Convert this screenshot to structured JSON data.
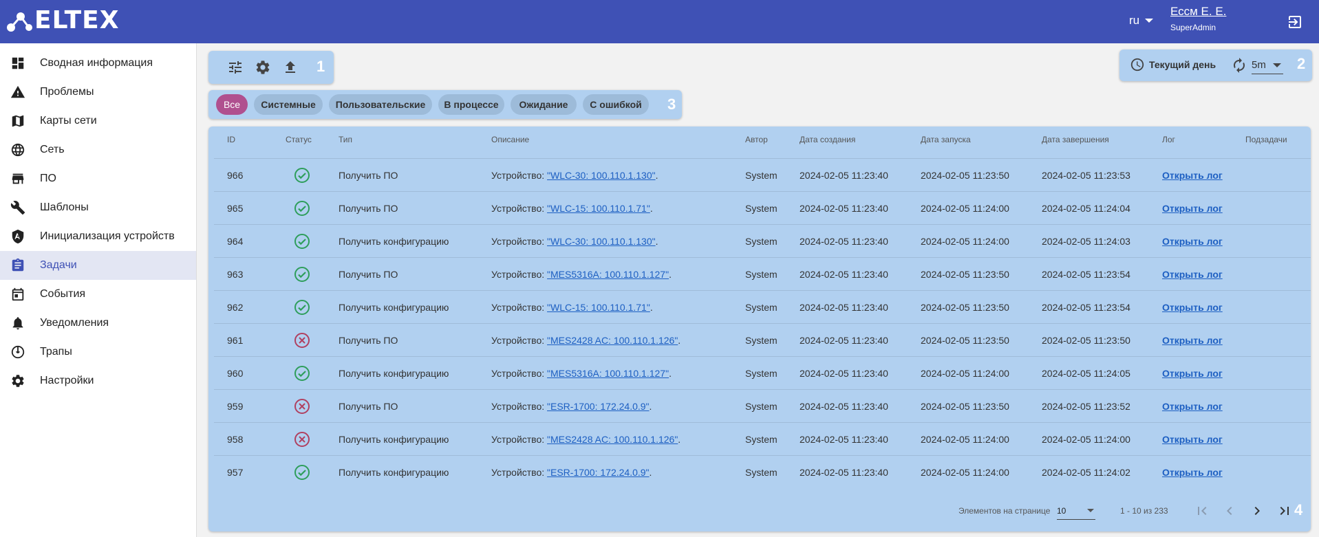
{
  "header": {
    "brand": "ELTEX",
    "lang": "ru",
    "user_name": "Ессм Е. Е.",
    "user_role": "SuperAdmin"
  },
  "sidebar": {
    "items": [
      {
        "label": "Сводная информация",
        "icon": "dashboard-icon"
      },
      {
        "label": "Проблемы",
        "icon": "warning-icon"
      },
      {
        "label": "Карты сети",
        "icon": "map-icon"
      },
      {
        "label": "Сеть",
        "icon": "globe-icon"
      },
      {
        "label": "ПО",
        "icon": "store-icon"
      },
      {
        "label": "Шаблоны",
        "icon": "wrench-icon"
      },
      {
        "label": "Инициализация устройств",
        "icon": "init-icon"
      },
      {
        "label": "Задачи",
        "icon": "clipboard-icon",
        "active": true
      },
      {
        "label": "События",
        "icon": "calendar-icon"
      },
      {
        "label": "Уведомления",
        "icon": "bell-icon"
      },
      {
        "label": "Трапы",
        "icon": "trap-icon"
      },
      {
        "label": "Настройки",
        "icon": "gear-icon"
      }
    ]
  },
  "zones": {
    "z1": "1",
    "z2": "2",
    "z3": "3",
    "z4": "4"
  },
  "toolbar2": {
    "period": "Текущий день",
    "refresh": "5m"
  },
  "filters": [
    "Все",
    "Системные",
    "Пользовательские",
    "В процессе",
    "Ожидание",
    "С ошибкой"
  ],
  "table": {
    "headers": {
      "id": "ID",
      "status": "Статус",
      "type": "Тип",
      "desc": "Описание",
      "author": "Автор",
      "created": "Дата создания",
      "started": "Дата запуска",
      "finished": "Дата завершения",
      "log": "Лог",
      "subtasks": "Подзадачи"
    },
    "rows": [
      {
        "id": "966",
        "status": "ok",
        "type": "Получить ПО",
        "desc_prefix": "Устройство: ",
        "device": "\"WLC-30: 100.110.1.130\"",
        "desc_suffix": " .",
        "author": "System",
        "created": "2024-02-05 11:23:40",
        "started": "2024-02-05 11:23:50",
        "finished": "2024-02-05 11:23:53",
        "log": "Открыть лог"
      },
      {
        "id": "965",
        "status": "ok",
        "type": "Получить ПО",
        "desc_prefix": "Устройство: ",
        "device": "\"WLC-15: 100.110.1.71\"",
        "desc_suffix": " .",
        "author": "System",
        "created": "2024-02-05 11:23:40",
        "started": "2024-02-05 11:24:00",
        "finished": "2024-02-05 11:24:04",
        "log": "Открыть лог"
      },
      {
        "id": "964",
        "status": "ok",
        "type": "Получить конфигурацию",
        "desc_prefix": "Устройство: ",
        "device": "\"WLC-30: 100.110.1.130\"",
        "desc_suffix": " .",
        "author": "System",
        "created": "2024-02-05 11:23:40",
        "started": "2024-02-05 11:24:00",
        "finished": "2024-02-05 11:24:03",
        "log": "Открыть лог"
      },
      {
        "id": "963",
        "status": "ok",
        "type": "Получить ПО",
        "desc_prefix": "Устройство: ",
        "device": "\"MES5316A: 100.110.1.127\"",
        "desc_suffix": " .",
        "author": "System",
        "created": "2024-02-05 11:23:40",
        "started": "2024-02-05 11:23:50",
        "finished": "2024-02-05 11:23:54",
        "log": "Открыть лог"
      },
      {
        "id": "962",
        "status": "ok",
        "type": "Получить конфигурацию",
        "desc_prefix": "Устройство: ",
        "device": "\"WLC-15: 100.110.1.71\"",
        "desc_suffix": ".",
        "author": "System",
        "created": "2024-02-05 11:23:40",
        "started": "2024-02-05 11:23:50",
        "finished": "2024-02-05 11:23:54",
        "log": "Открыть лог"
      },
      {
        "id": "961",
        "status": "error",
        "type": "Получить ПО",
        "desc_prefix": "Устройство: ",
        "device": "\"MES2428 AC: 100.110.1.126\"",
        "desc_suffix": " .",
        "author": "System",
        "created": "2024-02-05 11:23:40",
        "started": "2024-02-05 11:23:50",
        "finished": "2024-02-05 11:23:50",
        "log": "Открыть лог"
      },
      {
        "id": "960",
        "status": "ok",
        "type": "Получить конфигурацию",
        "desc_prefix": "Устройство: ",
        "device": "\"MES5316A: 100.110.1.127\"",
        "desc_suffix": " .",
        "author": "System",
        "created": "2024-02-05 11:23:40",
        "started": "2024-02-05 11:24:00",
        "finished": "2024-02-05 11:24:05",
        "log": "Открыть лог"
      },
      {
        "id": "959",
        "status": "error",
        "type": "Получить ПО",
        "desc_prefix": "Устройство: ",
        "device": "\"ESR-1700: 172.24.0.9\"",
        "desc_suffix": " .",
        "author": "System",
        "created": "2024-02-05 11:23:40",
        "started": "2024-02-05 11:23:50",
        "finished": "2024-02-05 11:23:52",
        "log": "Открыть лог"
      },
      {
        "id": "958",
        "status": "error",
        "type": "Получить конфигурацию",
        "desc_prefix": "Устройство: ",
        "device": "\"MES2428 AC: 100.110.1.126\"",
        "desc_suffix": " .",
        "author": "System",
        "created": "2024-02-05 11:23:40",
        "started": "2024-02-05 11:24:00",
        "finished": "2024-02-05 11:24:00",
        "log": "Открыть лог"
      },
      {
        "id": "957",
        "status": "ok",
        "type": "Получить конфигурацию",
        "desc_prefix": "Устройство: ",
        "device": "\"ESR-1700: 172.24.0.9\"",
        "desc_suffix": " .",
        "author": "System",
        "created": "2024-02-05 11:23:40",
        "started": "2024-02-05 11:24:00",
        "finished": "2024-02-05 11:24:02",
        "log": "Открыть лог"
      }
    ]
  },
  "pager": {
    "label": "Элементов на странице",
    "per_page": "10",
    "range": "1 - 10 из 233"
  },
  "colors": {
    "header": "#3f51b5",
    "panel": "#b1d0f0",
    "active_chip": "#b0508f",
    "ok": "#2e9e5b",
    "error": "#b04060",
    "link": "#1d5fc2"
  }
}
